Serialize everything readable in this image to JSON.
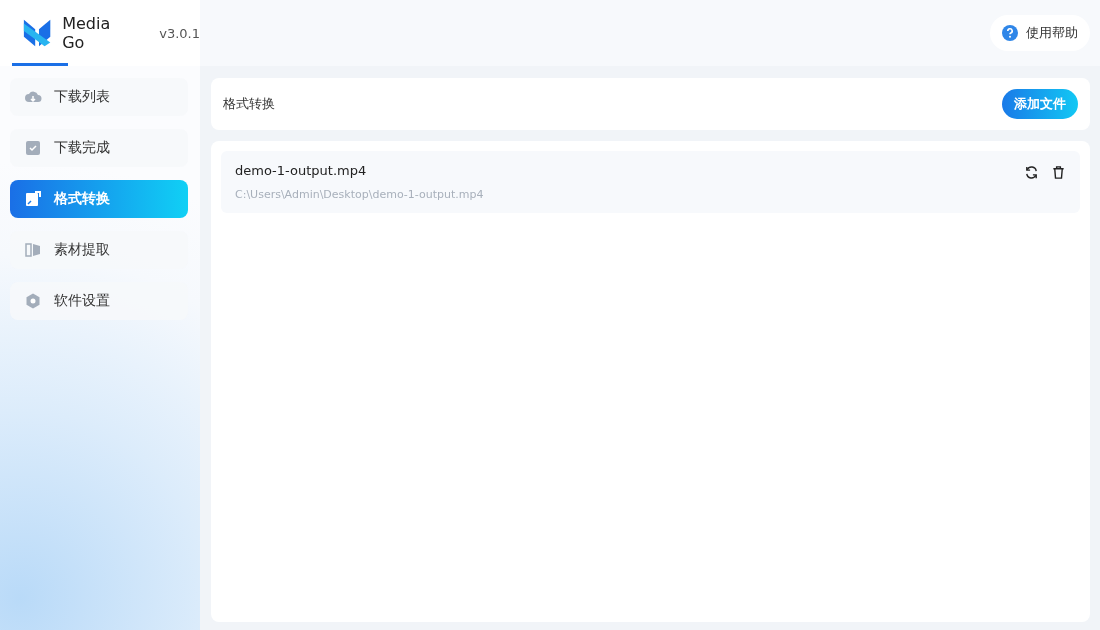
{
  "app": {
    "name": "Media Go",
    "version": "v3.0.1"
  },
  "help": {
    "label": "使用帮助"
  },
  "sidebar": {
    "items": [
      {
        "label": "下载列表",
        "kind": "cloud",
        "selected": false
      },
      {
        "label": "下载完成",
        "kind": "check",
        "selected": false
      },
      {
        "label": "格式转换",
        "kind": "convert",
        "selected": true
      },
      {
        "label": "素材提取",
        "kind": "extract",
        "selected": false
      },
      {
        "label": "软件设置",
        "kind": "settings",
        "selected": false
      }
    ]
  },
  "header": {
    "title": "格式转换",
    "button": "添加文件"
  },
  "files": [
    {
      "name": "demo-1-output.mp4",
      "path": "C:\\Users\\Admin\\Desktop\\demo-1-output.mp4"
    }
  ]
}
